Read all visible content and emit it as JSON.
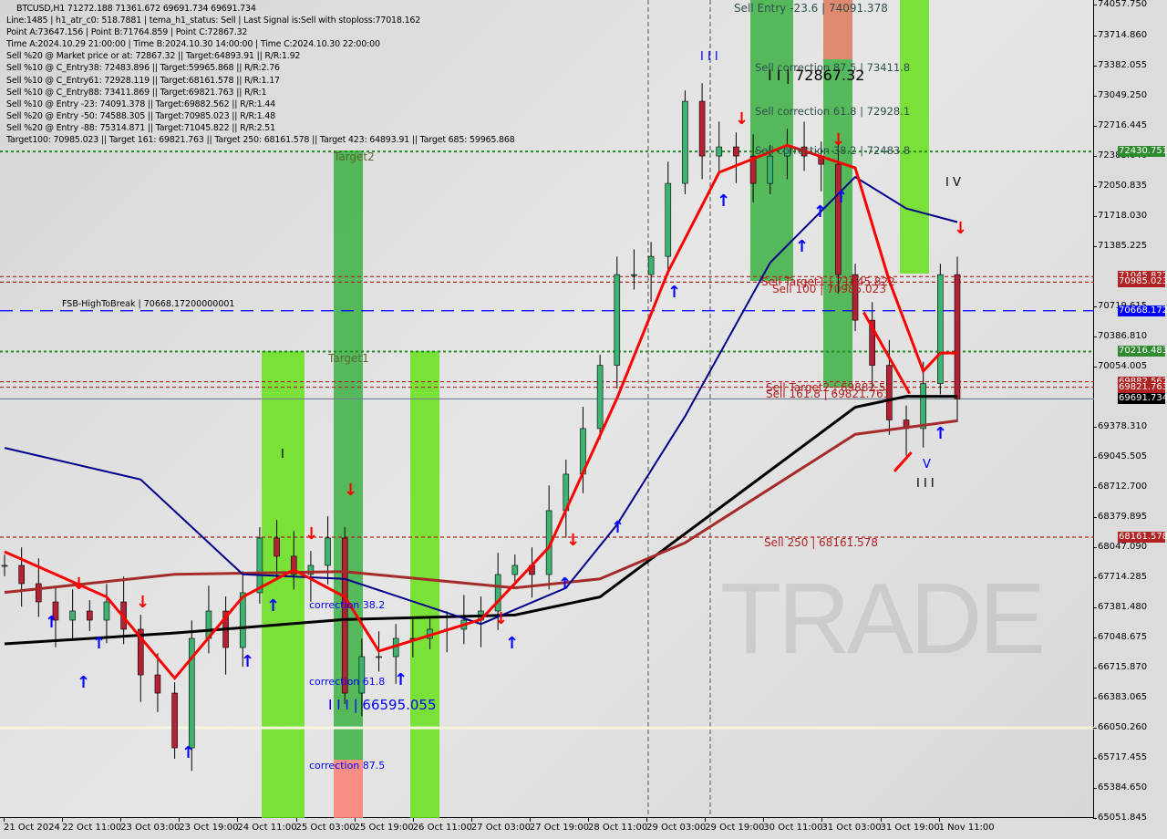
{
  "header": {
    "title": "BTCUSD,H1  71272.188 71361.672 69691.734 69691.734",
    "lines": [
      "Line:1485 | h1_atr_c0: 518.7881 | tema_h1_status: Sell | Last Signal is:Sell with stoploss:77018.162",
      "Point A:73647.156 | Point B:71764.859 | Point C:72867.32",
      "Time A:2024.10.29 21:00:00 | Time B:2024.10.30 14:00:00 | Time C:2024.10.30 22:00:00",
      "Sell %20 @ Market price or at: 72867.32 || Target:64893.91 || R/R:1.92",
      "Sell %10 @ C_Entry38: 72483.896 || Target:59965.868 || R/R:2.76",
      "Sell %10 @ C_Entry61: 72928.119 || Target:68161.578 || R/R:1.17",
      "Sell %10 @ C_Entry88: 73411.869 || Target:69821.763 || R/R:1",
      "Sell %10 @ Entry -23: 74091.378 || Target:69882.562 || R/R:1.44",
      "Sell %20 @ Entry -50: 74588.305 || Target:70985.023 || R/R:1.48",
      "Sell %20 @ Entry -88: 75314.871 || Target:71045.822 || R/R:2.51",
      "Target100: 70985.023 || Target 161: 69821.763 || Target 250: 68161.578 || Target 423: 64893.91 || Target 685: 59965.868"
    ]
  },
  "watermark": "MAKZI TRADE",
  "chart_data": {
    "type": "candlestick",
    "symbol": "BTCUSD",
    "timeframe": "H1",
    "ylim": [
      65051.845,
      74057.75
    ],
    "y_ticks": [
      74057.75,
      73714.86,
      73382.055,
      73049.25,
      72716.445,
      72383.64,
      72050.835,
      71718.03,
      71385.225,
      70719.615,
      70386.81,
      70054.005,
      69378.31,
      69045.505,
      68712.7,
      68379.895,
      68047.09,
      67714.285,
      67381.48,
      67048.675,
      66715.87,
      66383.065,
      66050.26,
      65717.455,
      65384.65,
      65051.845
    ],
    "x_ticks": [
      "21 Oct 2024",
      "22 Oct 11:00",
      "23 Oct 03:00",
      "23 Oct 19:00",
      "24 Oct 11:00",
      "25 Oct 03:00",
      "25 Oct 19:00",
      "26 Oct 11:00",
      "27 Oct 03:00",
      "27 Oct 19:00",
      "28 Oct 11:00",
      "29 Oct 03:00",
      "29 Oct 19:00",
      "30 Oct 11:00",
      "31 Oct 03:00",
      "31 Oct 19:00",
      "1 Nov 11:00"
    ],
    "closes": [
      67849,
      67647,
      67445,
      67243,
      67344,
      67243,
      67445,
      67142,
      66637,
      66435,
      65829,
      67041,
      67344,
      66940,
      67546,
      68152,
      67950,
      67748,
      67849,
      68152,
      66435,
      66839,
      66839,
      67041,
      67041,
      67142,
      67142,
      67243,
      67344,
      67748,
      67849,
      67748,
      68455,
      68859,
      69364,
      70064,
      71068,
      71068,
      71270,
      72078,
      72987,
      72381,
      72482,
      72381,
      72078,
      72381,
      72482,
      72381,
      72290,
      71068,
      70563,
      70064,
      69459,
      69364,
      69863,
      71068,
      69691.734
    ],
    "moving_averages": [
      {
        "color": "#000000",
        "points": [
          [
            0,
            66980
          ],
          [
            10,
            67100
          ],
          [
            20,
            67250
          ],
          [
            30,
            67300
          ],
          [
            35,
            67500
          ],
          [
            40,
            68200
          ],
          [
            45,
            68900
          ],
          [
            50,
            69600
          ],
          [
            53,
            69720
          ],
          [
            56,
            69720
          ]
        ]
      },
      {
        "color": "#a52a2a",
        "points": [
          [
            0,
            67550
          ],
          [
            10,
            67750
          ],
          [
            20,
            67780
          ],
          [
            30,
            67600
          ],
          [
            35,
            67700
          ],
          [
            40,
            68100
          ],
          [
            45,
            68700
          ],
          [
            50,
            69300
          ],
          [
            56,
            69450
          ]
        ]
      },
      {
        "color": "#00008b",
        "points": [
          [
            0,
            69150
          ],
          [
            8,
            68800
          ],
          [
            14,
            67750
          ],
          [
            20,
            67700
          ],
          [
            28,
            67200
          ],
          [
            33,
            67600
          ],
          [
            36,
            68300
          ],
          [
            40,
            69500
          ],
          [
            45,
            71200
          ],
          [
            50,
            72150
          ],
          [
            53,
            71800
          ],
          [
            56,
            71650
          ]
        ]
      },
      {
        "color": "#ff0000",
        "points": [
          [
            0,
            68000
          ],
          [
            6,
            67500
          ],
          [
            10,
            66600
          ],
          [
            14,
            67500
          ],
          [
            17,
            67800
          ],
          [
            20,
            67500
          ],
          [
            22,
            66900
          ],
          [
            28,
            67250
          ],
          [
            32,
            68050
          ],
          [
            36,
            69700
          ],
          [
            39,
            71100
          ],
          [
            42,
            72200
          ],
          [
            46,
            72500
          ],
          [
            50,
            72250
          ],
          [
            52,
            71000
          ],
          [
            54,
            70000
          ],
          [
            55,
            70200
          ],
          [
            56,
            70200
          ]
        ]
      }
    ],
    "levels": [
      {
        "value": 72430.751,
        "color": "#228b22",
        "style": "dotted",
        "badge": "72430.751"
      },
      {
        "value": 71045.822,
        "color": "#b22222",
        "style": "dashed",
        "badge": "71045.822"
      },
      {
        "value": 70985.023,
        "color": "#b22222",
        "style": "dashed",
        "badge": "70985.023"
      },
      {
        "value": 70668.172,
        "color": "#0000ff",
        "style": "longdash",
        "badge": "70668.172"
      },
      {
        "value": 70216.483,
        "color": "#228b22",
        "style": "dotted",
        "badge": "70216.483"
      },
      {
        "value": 69882.562,
        "color": "#b22222",
        "style": "dashed",
        "badge": "69882.562"
      },
      {
        "value": 69821.763,
        "color": "#b22222",
        "style": "dashed",
        "badge": "69821.763"
      },
      {
        "value": 69691.734,
        "color": "#708090",
        "style": "solid",
        "badge": "69691.734",
        "badge_color": "#000000"
      },
      {
        "value": 68161.578,
        "color": "#b22222",
        "style": "dashed",
        "badge": "68161.578"
      },
      {
        "value": 66050.26,
        "color": "#f5f5dc",
        "style": "solid"
      }
    ],
    "annotations": [
      {
        "text": "Sell Entry -23.6 | 74091.378",
        "color": "#2f4f4f"
      },
      {
        "text": "Sell correction 87.5 | 73411.8",
        "color": "#2f4f4f"
      },
      {
        "text": "I I | 72867.32",
        "color": "#000000"
      },
      {
        "text": "Sell correction 61.8 | 72928.1",
        "color": "#2f4f4f"
      },
      {
        "text": "Sell correction 38.2 | 72483.8",
        "color": "#2f4f4f"
      },
      {
        "text": "Sell Target1 | 71045.822",
        "color": "#b22222"
      },
      {
        "text": "Sell 100 | 70985.023",
        "color": "#b22222"
      },
      {
        "text": "Sell Target2 | 69882.56",
        "color": "#b22222"
      },
      {
        "text": "Sell 161.8 | 69821.763",
        "color": "#b22222"
      },
      {
        "text": "Sell 250 | 68161.578",
        "color": "#b22222"
      },
      {
        "text": "FSB-HighToBreak | 70668.17200000001",
        "color": "#000000"
      },
      {
        "text": "Target2",
        "color": "#556b2f"
      },
      {
        "text": "Target1",
        "color": "#556b2f"
      },
      {
        "text": "correction 38.2",
        "color": "#0000ff"
      },
      {
        "text": "correction 61.8",
        "color": "#0000ff"
      },
      {
        "text": "correction 87.5",
        "color": "#0000ff"
      },
      {
        "text": "I I I | 66595.055",
        "color": "#0000ff"
      },
      {
        "text": "I V",
        "color": "#000000"
      },
      {
        "text": "I I I",
        "color": "#000000"
      },
      {
        "text": "I I I",
        "color": "#0000ff"
      },
      {
        "text": "I",
        "color": "#000000"
      },
      {
        "text": "V",
        "color": "#0000ff"
      }
    ],
    "colors": {
      "up": "#3cb371",
      "down": "#b22234",
      "zone_green": "#66e01a",
      "zone_darkgreen": "#3cb043",
      "zone_red": "#fa8072"
    }
  }
}
